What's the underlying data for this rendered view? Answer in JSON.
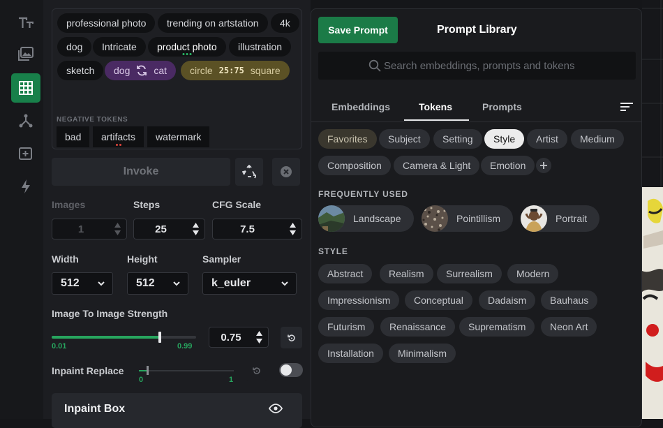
{
  "rail": {
    "icons": [
      "text-icon",
      "image-icon",
      "grid-icon",
      "nodes-icon",
      "add-image-icon",
      "lightning-icon"
    ]
  },
  "tags": {
    "positive": [
      "professional photo",
      "trending on artstation",
      "4k",
      "dog",
      "Intricate",
      "product photo",
      "illustration",
      "sketch"
    ],
    "blend": {
      "left": "dog",
      "right": "cat"
    },
    "ratio": {
      "left": "circle",
      "value": "25:75",
      "right": "square"
    },
    "negative_label": "NEGATIVE TOKENS",
    "negative": [
      "bad",
      "artifacts",
      "watermark"
    ]
  },
  "controls": {
    "invoke_label": "Invoke",
    "images_label": "Images",
    "images_value": "1",
    "steps_label": "Steps",
    "steps_value": "25",
    "cfg_label": "CFG Scale",
    "cfg_value": "7.5",
    "width_label": "Width",
    "width_value": "512",
    "height_label": "Height",
    "height_value": "512",
    "sampler_label": "Sampler",
    "sampler_value": "k_euler",
    "strength_label": "Image To Image Strength",
    "strength_value": "0.75",
    "strength_fraction": 0.75,
    "strength_min": "0.01",
    "strength_max": "0.99",
    "inpaint_label": "Inpaint Replace",
    "inpaint_min": "0",
    "inpaint_max": "1",
    "inpaint_box_label": "Inpaint Box"
  },
  "library": {
    "save_label": "Save Prompt",
    "title": "Prompt Library",
    "search_placeholder": "Search embeddings, prompts and tokens",
    "tabs": [
      "Embeddings",
      "Tokens",
      "Prompts"
    ],
    "active_tab": "Tokens",
    "categories": [
      "Favorites",
      "Subject",
      "Setting",
      "Style",
      "Artist",
      "Medium",
      "Composition",
      "Camera & Light",
      "Emotion"
    ],
    "selected_category": "Style",
    "frequent_label": "FREQUENTLY USED",
    "frequent": [
      "Landscape",
      "Pointillism",
      "Portrait"
    ],
    "style_label": "STYLE",
    "styles": [
      "Abstract",
      "Realism",
      "Surrealism",
      "Modern",
      "Impressionism",
      "Conceptual",
      "Dadaism",
      "Bauhaus",
      "Futurism",
      "Renaissance",
      "Suprematism",
      "Neon Art",
      "Installation",
      "Minimalism"
    ]
  },
  "colors": {
    "accent": "#1b7b47",
    "blend": "#4a2a63",
    "ratio": "#5b5125",
    "slider": "#27a55e"
  }
}
